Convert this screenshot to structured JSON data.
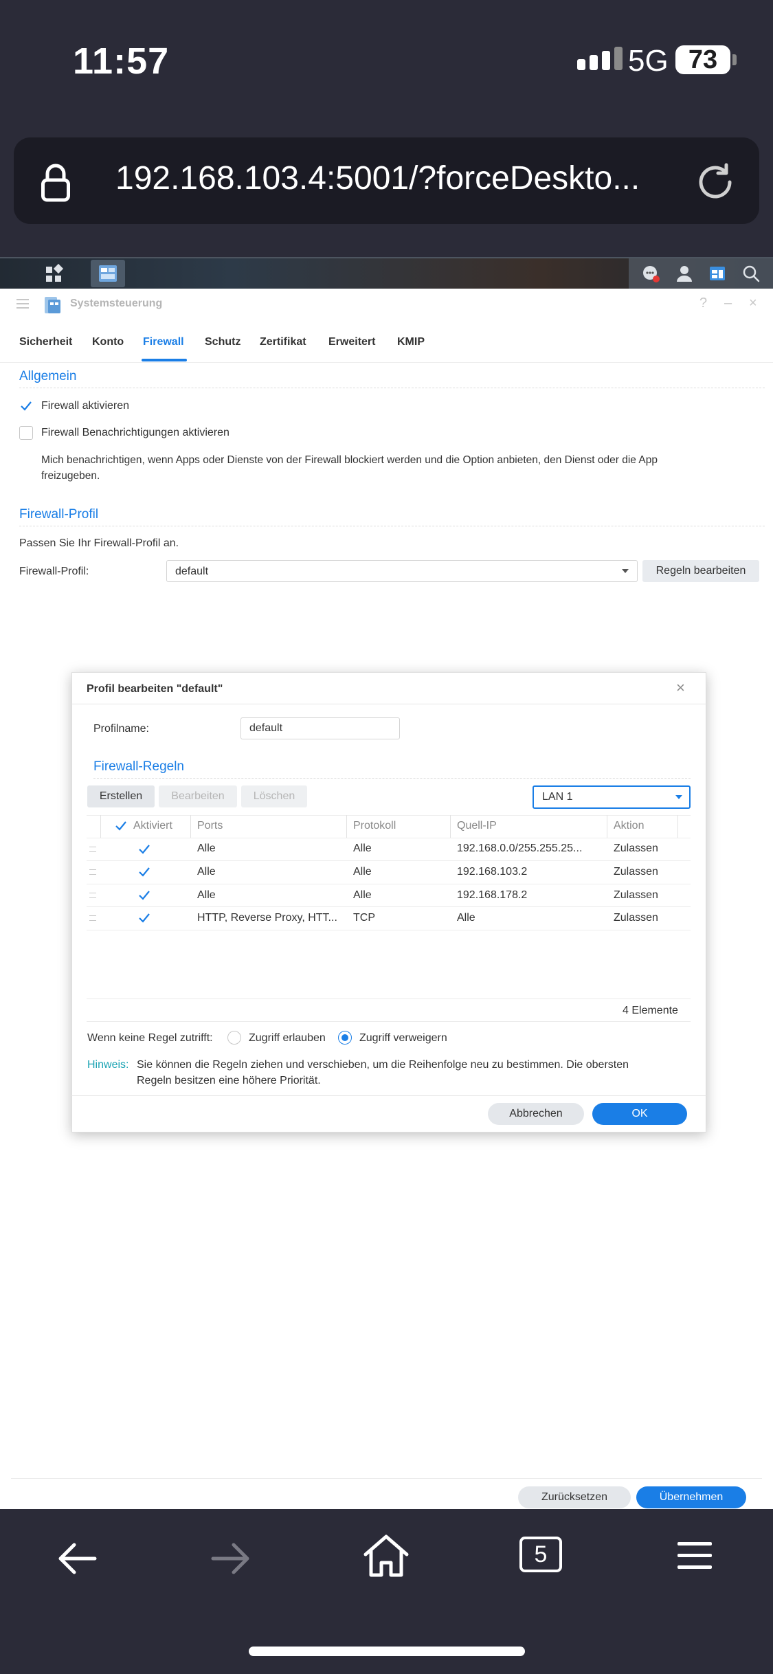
{
  "status_bar": {
    "time": "11:57",
    "network": "5G",
    "battery": "73"
  },
  "browser": {
    "url": "192.168.103.4:5001/?forceDeskto...",
    "tabs_count": "5"
  },
  "window": {
    "title": "Systemsteuerung",
    "tabs": [
      "Sicherheit",
      "Konto",
      "Firewall",
      "Schutz",
      "Zertifikat",
      "Erweitert",
      "KMIP"
    ],
    "active_tab": "Firewall"
  },
  "general": {
    "title": "Allgemein",
    "enable_firewall": "Firewall aktivieren",
    "enable_notifications": "Firewall Benachrichtigungen aktivieren",
    "notify_desc_line1": "Mich benachrichtigen, wenn Apps oder Dienste von der Firewall blockiert werden und die Option anbieten, den Dienst oder die App",
    "notify_desc_line2": "freizugeben."
  },
  "profile": {
    "title": "Firewall-Profil",
    "hint": "Passen Sie Ihr Firewall-Profil an.",
    "label": "Firewall-Profil:",
    "value": "default",
    "edit_button": "Regeln bearbeiten"
  },
  "dialog": {
    "title": "Profil bearbeiten \"default\"",
    "profile_name_label": "Profilname:",
    "profile_name_value": "default",
    "rules_title": "Firewall-Regeln",
    "btn_create": "Erstellen",
    "btn_edit": "Bearbeiten",
    "btn_delete": "Löschen",
    "interface": "LAN 1",
    "columns": [
      "Aktiviert",
      "Ports",
      "Protokoll",
      "Quell-IP",
      "Aktion"
    ],
    "rows": [
      {
        "ports": "Alle",
        "protocol": "Alle",
        "source_ip": "192.168.0.0/255.255.25...",
        "action": "Zulassen"
      },
      {
        "ports": "Alle",
        "protocol": "Alle",
        "source_ip": "192.168.103.2",
        "action": "Zulassen"
      },
      {
        "ports": "Alle",
        "protocol": "Alle",
        "source_ip": "192.168.178.2",
        "action": "Zulassen"
      },
      {
        "ports": "HTTP, Reverse Proxy, HTT...",
        "protocol": "TCP",
        "source_ip": "Alle",
        "action": "Zulassen"
      }
    ],
    "count": "4 Elemente",
    "no_rule_label": "Wenn keine Regel zutrifft:",
    "allow_access": "Zugriff erlauben",
    "deny_access": "Zugriff verweigern",
    "note_label": "Hinweis:",
    "note_line1": "Sie können die Regeln ziehen und verschieben, um die Reihenfolge neu zu bestimmen. Die obersten",
    "note_line2": "Regeln besitzen eine höhere Priorität.",
    "cancel": "Abbrechen",
    "ok": "OK"
  },
  "footer": {
    "reset": "Zurücksetzen",
    "apply": "Übernehmen"
  },
  "colors": {
    "accent": "#1a7ee6",
    "dark_bg": "#2b2b38"
  }
}
